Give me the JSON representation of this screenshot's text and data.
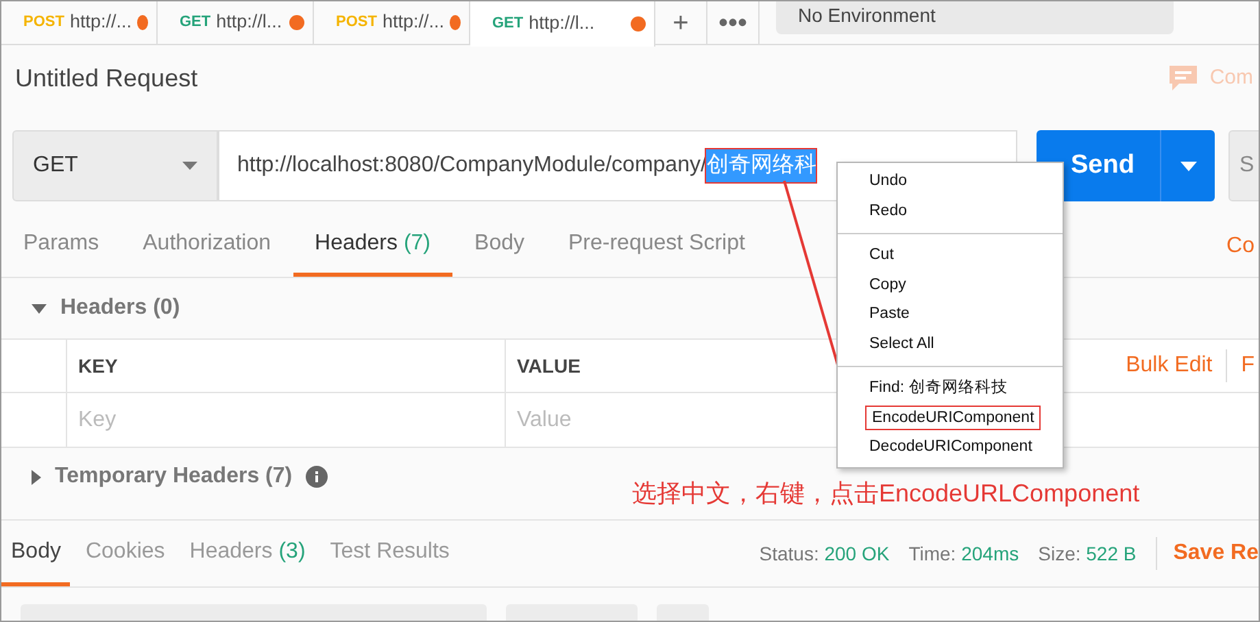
{
  "request_tabs": [
    {
      "method": "POST",
      "label": "http://...",
      "unsaved": true,
      "selected": false
    },
    {
      "method": "GET",
      "label": "http://l...",
      "unsaved": true,
      "selected": false
    },
    {
      "method": "POST",
      "label": "http://...",
      "unsaved": true,
      "selected": false
    },
    {
      "method": "GET",
      "label": "http://l...",
      "unsaved": true,
      "selected": true
    }
  ],
  "tab_actions": [
    "+",
    "•••"
  ],
  "environment": "No Environment",
  "title": "Untitled Request",
  "comments_label": "Com",
  "method": "GET",
  "url": "http://localhost:8080/CompanyModule/company/",
  "url_selection": {
    "text": "创奇网络科",
    "boxed": true
  },
  "send_label": "Send",
  "save_label": "S",
  "request_sections": [
    {
      "label": "Params",
      "selected": false
    },
    {
      "label": "Authorization",
      "selected": false
    },
    {
      "label": "Headers",
      "count": "(7)",
      "selected": true
    },
    {
      "label": "Body",
      "selected": false
    },
    {
      "label": "Pre-request Script",
      "selected": false
    }
  ],
  "code_link": "Co",
  "headers_group": {
    "label": "Headers",
    "count": "(0)",
    "expanded": true
  },
  "table": {
    "columns": [
      "KEY",
      "VALUE"
    ],
    "actions": [
      "Bulk Edit",
      "F"
    ],
    "placeholders": [
      "Key",
      "Value"
    ]
  },
  "temporary_headers": {
    "label": "Temporary Headers",
    "count": "(7)",
    "expanded": false
  },
  "annotation": "选择中文，右键，点击EncodeURLComponent",
  "response_tabs": [
    {
      "label": "Body",
      "selected": true
    },
    {
      "label": "Cookies",
      "selected": false
    },
    {
      "label": "Headers",
      "count": "(3)",
      "selected": false
    },
    {
      "label": "Test Results",
      "selected": false
    }
  ],
  "status": [
    {
      "label": "Status:",
      "value": "200 OK"
    },
    {
      "label": "Time:",
      "value": "204ms"
    },
    {
      "label": "Size:",
      "value": "522 B"
    }
  ],
  "save_response": "Save Re",
  "context_menu": [
    [
      {
        "label": "Undo",
        "highlighted": false
      },
      {
        "label": "Redo",
        "highlighted": false
      }
    ],
    [
      {
        "label": "Cut",
        "highlighted": false
      },
      {
        "label": "Copy",
        "highlighted": false
      },
      {
        "label": "Paste",
        "highlighted": false
      },
      {
        "label": "Select All",
        "highlighted": false
      }
    ],
    [
      {
        "label": "Find: 创奇网络科技",
        "highlighted": false
      },
      {
        "label": "EncodeURIComponent",
        "highlighted": true
      },
      {
        "label": "DecodeURIComponent",
        "highlighted": false
      }
    ]
  ]
}
